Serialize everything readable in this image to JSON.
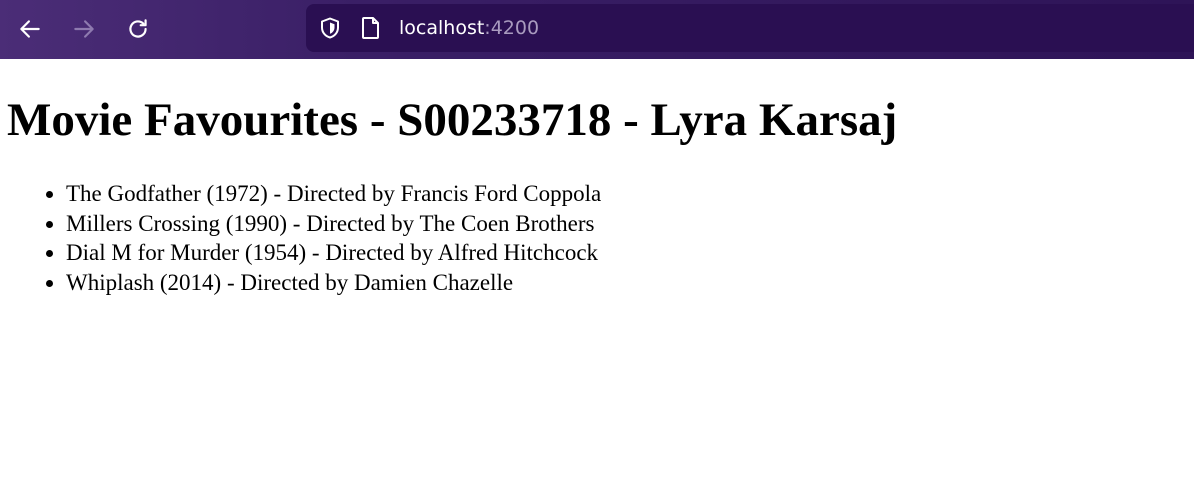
{
  "browser": {
    "nav": {
      "back_icon": "arrow-left-icon",
      "forward_icon": "arrow-right-icon",
      "reload_icon": "reload-icon"
    },
    "address_bar": {
      "host": "localhost",
      "port": ":4200",
      "security_icon": "shield-icon",
      "page_icon": "page-icon"
    },
    "colors": {
      "toolbar": "#3a1f66",
      "url_bar": "#2a0f52",
      "icon_active": "#ffffff",
      "icon_disabled": "#8e7aaf",
      "port_text": "#a99bbf"
    }
  },
  "page": {
    "title": "Movie Favourites - S00233718 - Lyra Karsaj",
    "movies": [
      "The Godfather (1972) - Directed by Francis Ford Coppola",
      "Millers Crossing (1990) - Directed by The Coen Brothers",
      "Dial M for Murder (1954) - Directed by Alfred Hitchcock",
      "Whiplash (2014) - Directed by Damien Chazelle"
    ]
  }
}
